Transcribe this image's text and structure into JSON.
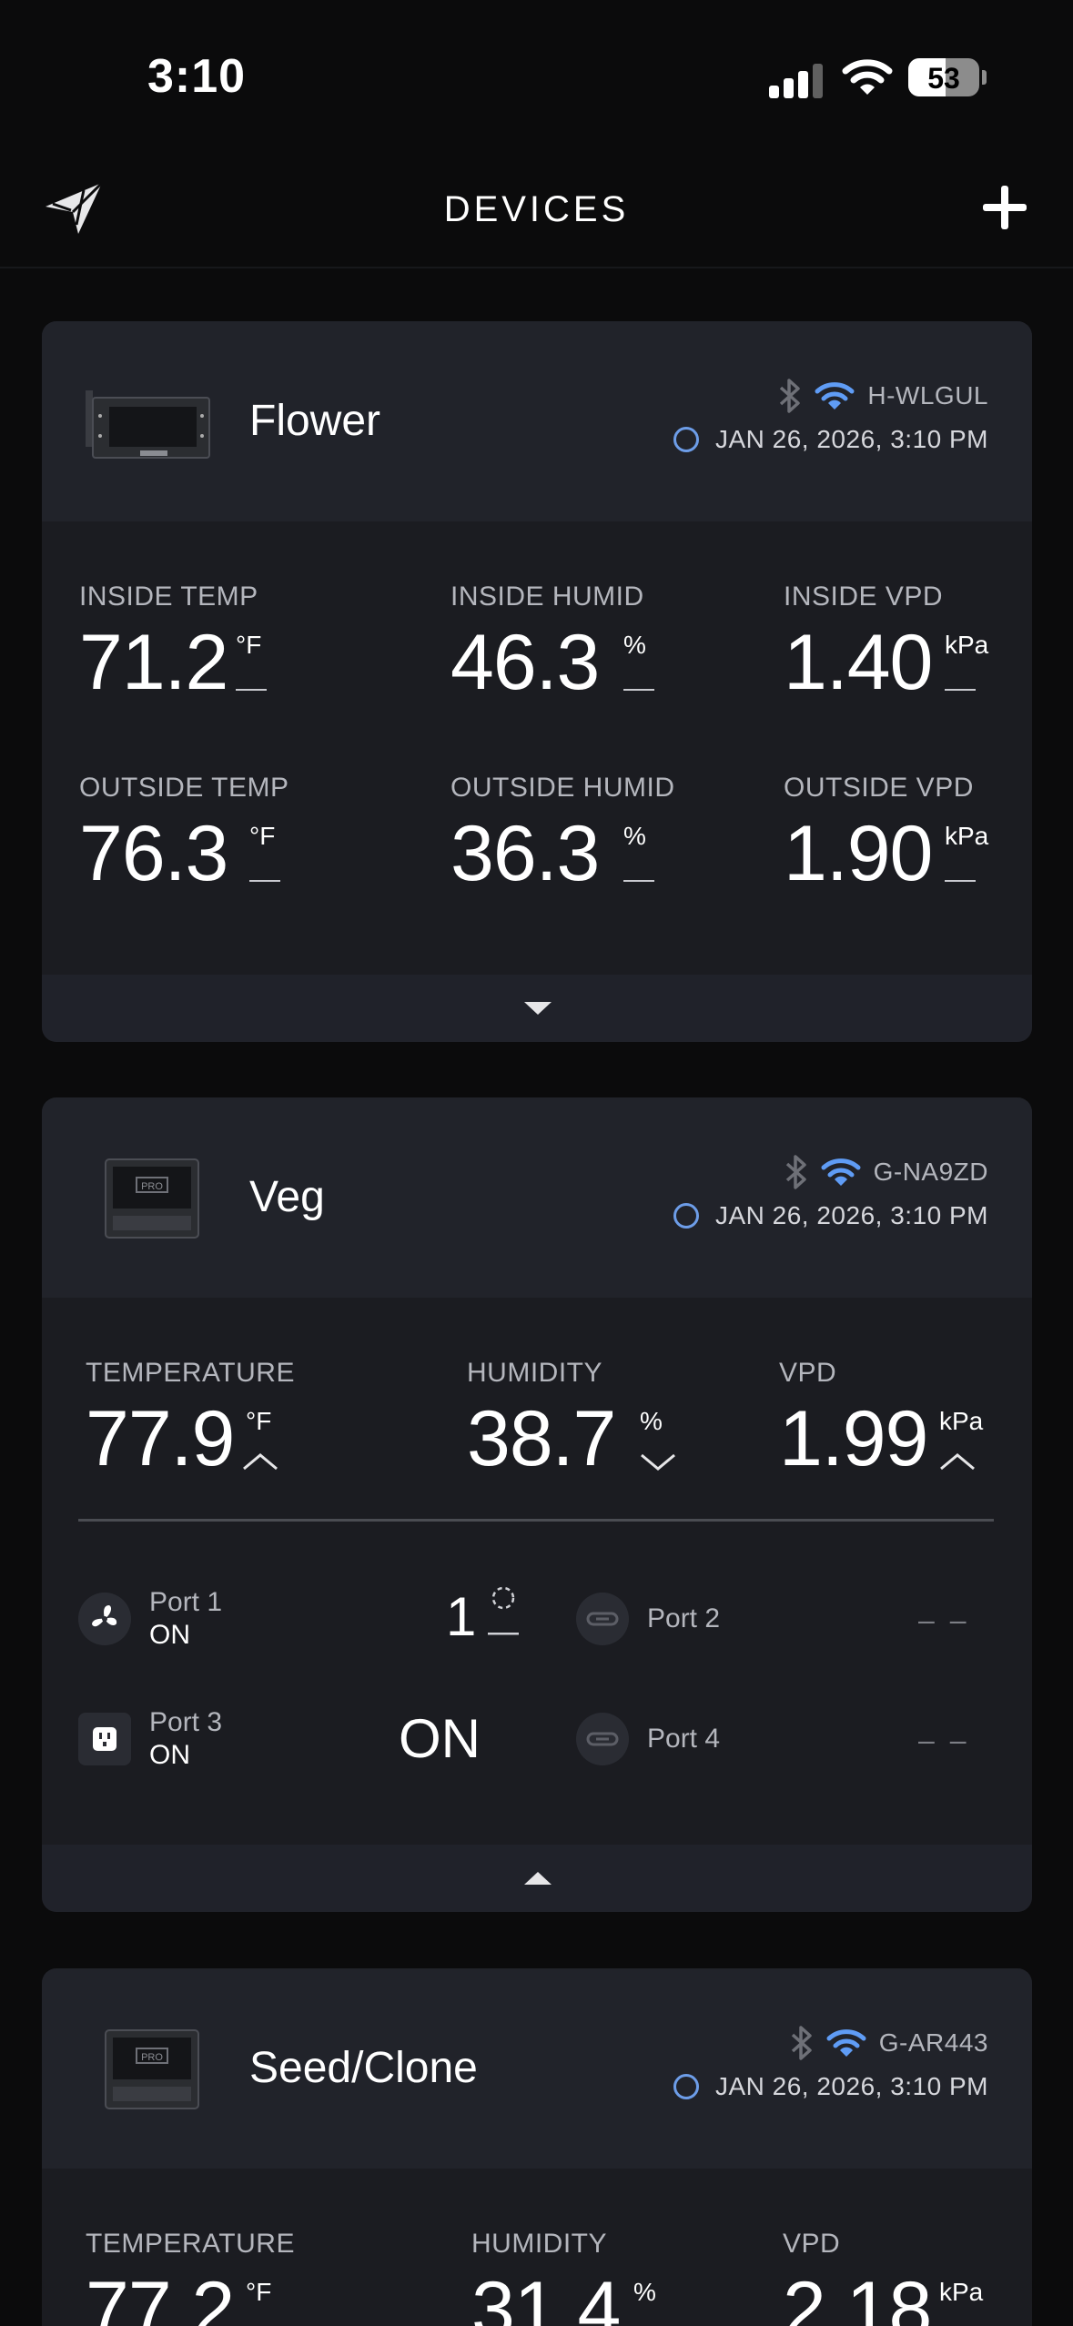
{
  "status_bar": {
    "time": "3:10",
    "battery": "53",
    "battery_level": 0.53
  },
  "header": {
    "title": "DEVICES",
    "logo_icon": "paper-plane-logo",
    "add_icon": "plus-icon"
  },
  "colors": {
    "background": "#0b0b0c",
    "card": "#1b1c21",
    "card_head": "#21232a",
    "accent": "#6d9de8",
    "wifi": "#5f9cf5"
  },
  "devices": [
    {
      "name": "Flower",
      "id": "H-WLGUL",
      "timestamp": "JAN 26, 2026, 3:10 PM",
      "metrics": [
        {
          "label": "INSIDE TEMP",
          "value": "71.2",
          "unit": "°F"
        },
        {
          "label": "INSIDE HUMID",
          "value": "46.3",
          "unit": "%"
        },
        {
          "label": "INSIDE VPD",
          "value": "1.40",
          "unit": "kPa"
        },
        {
          "label": "OUTSIDE TEMP",
          "value": "76.3",
          "unit": "°F"
        },
        {
          "label": "OUTSIDE HUMID",
          "value": "36.3",
          "unit": "%"
        },
        {
          "label": "OUTSIDE VPD",
          "value": "1.90",
          "unit": "kPa"
        }
      ]
    },
    {
      "name": "Veg",
      "id": "G-NA9ZD",
      "timestamp": "JAN 26, 2026, 3:10 PM",
      "metrics": [
        {
          "label": "TEMPERATURE",
          "value": "77.9",
          "unit": "°F",
          "trend": "up"
        },
        {
          "label": "HUMIDITY",
          "value": "38.7",
          "unit": "%",
          "trend": "down"
        },
        {
          "label": "VPD",
          "value": "1.99",
          "unit": "kPa",
          "trend": "up"
        }
      ],
      "ports": [
        {
          "name": "Port 1",
          "state": "ON",
          "value": "1",
          "icon": "fan-icon"
        },
        {
          "name": "Port 2",
          "state": "",
          "value": "– –",
          "icon": "link-icon"
        },
        {
          "name": "Port 3",
          "state": "ON",
          "value": "ON",
          "icon": "outlet-icon"
        },
        {
          "name": "Port 4",
          "state": "",
          "value": "– –",
          "icon": "link-icon"
        }
      ]
    },
    {
      "name": "Seed/Clone",
      "id": "G-AR443",
      "timestamp": "JAN 26, 2026, 3:10 PM",
      "metrics": [
        {
          "label": "TEMPERATURE",
          "value": "77.2",
          "unit": "°F"
        },
        {
          "label": "HUMIDITY",
          "value": "31.4",
          "unit": "%"
        },
        {
          "label": "VPD",
          "value": "2.18",
          "unit": "kPa"
        }
      ]
    }
  ]
}
